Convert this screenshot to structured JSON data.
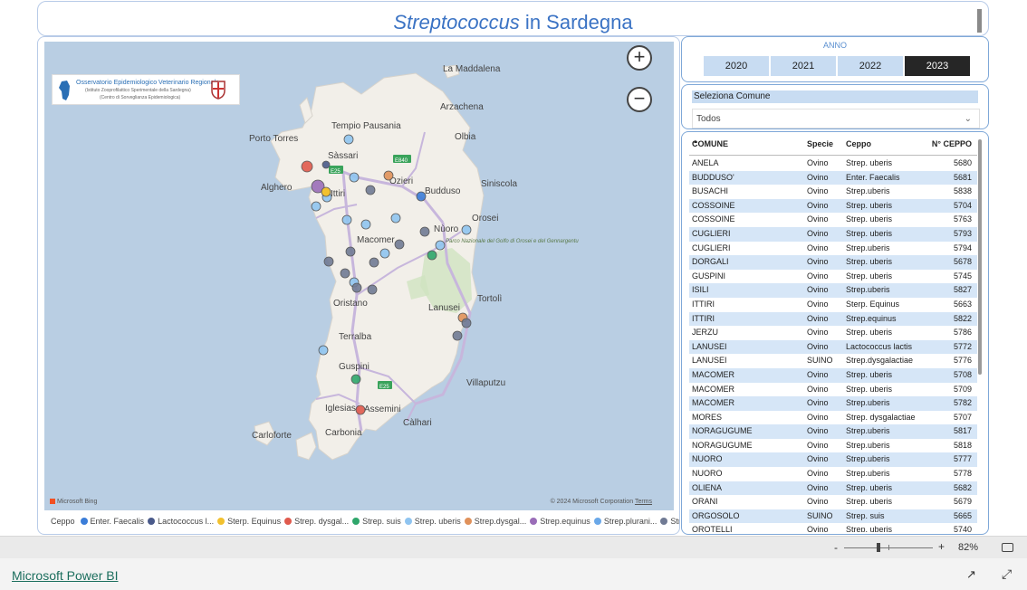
{
  "title": {
    "italic": "Streptococcus",
    "rest": " in Sardegna"
  },
  "map": {
    "zoom_in": "+",
    "zoom_out": "−",
    "places": [
      "La Maddalena",
      "Arzachena",
      "Tempio Pausania",
      "Olbia",
      "Porto Torres",
      "Sàssari",
      "Alghero",
      "Ozieri",
      "Ittiri",
      "Budduso",
      "Siniscola",
      "Orosei",
      "Nùoro",
      "Macomer",
      "Parco Nazionale del Golfo di Orosei e del Gennargentu",
      "Oristano",
      "Tortolì",
      "Lanusei",
      "Terralba",
      "Guspini",
      "Villaputzu",
      "Iglesias",
      "Assemini",
      "Càlhari",
      "Carloforte",
      "Carbonia"
    ],
    "road_labels": [
      "E25",
      "E840",
      "E25",
      "E25"
    ],
    "logo": {
      "line1": "Osservatorio Epidemiologico Veterinario Regionale",
      "line2": "(Istituto Zooprofilattico Sperimentale della Sardegna)",
      "line3": "(Centro di Sorveglianza Epidemiologica)"
    },
    "bing": "Microsoft Bing",
    "copyright": "© 2024 Microsoft Corporation",
    "terms": "Terms"
  },
  "legend": {
    "title": "Ceppo",
    "items": [
      {
        "label": "Enter. Faecalis",
        "color": "#3b7dd8"
      },
      {
        "label": "Lactococcus l...",
        "color": "#4a5a8a"
      },
      {
        "label": "Sterp. Equinus",
        "color": "#f2c12e"
      },
      {
        "label": "Strep. dysgal...",
        "color": "#e05a4d"
      },
      {
        "label": "Strep. suis",
        "color": "#2fa66b"
      },
      {
        "label": "Strep. uberis",
        "color": "#8fc4f0"
      },
      {
        "label": "Strep.dysgal...",
        "color": "#e0915a"
      },
      {
        "label": "Strep.equinus",
        "color": "#9a6db8"
      },
      {
        "label": "Strep.plurani...",
        "color": "#6aa8e8"
      },
      {
        "label": "Strep.uberis",
        "color": "#707a94"
      }
    ]
  },
  "year_slicer": {
    "label": "ANNO",
    "years": [
      "2020",
      "2021",
      "2022",
      "2023"
    ],
    "selected": "2023"
  },
  "comune_slicer": {
    "label": "Seleziona Comune",
    "value": "Todos"
  },
  "table": {
    "headers": [
      "COMUNE",
      "Specie",
      "Ceppo",
      "N° CEPPO"
    ],
    "rows": [
      [
        "ANELA",
        "Ovino",
        "Strep. uberis",
        "5680"
      ],
      [
        "BUDDUSO'",
        "Ovino",
        "Enter. Faecalis",
        "5681"
      ],
      [
        "BUSACHI",
        "Ovino",
        "Strep.uberis",
        "5838"
      ],
      [
        "COSSOINE",
        "Ovino",
        "Strep. uberis",
        "5704"
      ],
      [
        "COSSOINE",
        "Ovino",
        "Strep. uberis",
        "5763"
      ],
      [
        "CUGLIERI",
        "Ovino",
        "Strep. uberis",
        "5793"
      ],
      [
        "CUGLIERI",
        "Ovino",
        "Strep.uberis",
        "5794"
      ],
      [
        "DORGALI",
        "Ovino",
        "Strep. uberis",
        "5678"
      ],
      [
        "GUSPINI",
        "Ovino",
        "Strep. uberis",
        "5745"
      ],
      [
        "ISILI",
        "Ovino",
        "Strep.uberis",
        "5827"
      ],
      [
        "ITTIRI",
        "Ovino",
        "Sterp. Equinus",
        "5663"
      ],
      [
        "ITTIRI",
        "Ovino",
        "Strep.equinus",
        "5822"
      ],
      [
        "JERZU",
        "Ovino",
        "Strep. uberis",
        "5786"
      ],
      [
        "LANUSEI",
        "Ovino",
        "Lactococcus lactis",
        "5772"
      ],
      [
        "LANUSEI",
        "SUINO",
        "Strep.dysgalactiae",
        "5776"
      ],
      [
        "MACOMER",
        "Ovino",
        "Strep. uberis",
        "5708"
      ],
      [
        "MACOMER",
        "Ovino",
        "Strep. uberis",
        "5709"
      ],
      [
        "MACOMER",
        "Ovino",
        "Strep.uberis",
        "5782"
      ],
      [
        "MORES",
        "Ovino",
        "Strep. dysgalactiae",
        "5707"
      ],
      [
        "NORAGUGUME",
        "Ovino",
        "Strep.uberis",
        "5817"
      ],
      [
        "NORAGUGUME",
        "Ovino",
        "Strep.uberis",
        "5818"
      ],
      [
        "NUORO",
        "Ovino",
        "Strep.uberis",
        "5777"
      ],
      [
        "NUORO",
        "Ovino",
        "Strep.uberis",
        "5778"
      ],
      [
        "OLIENA",
        "Ovino",
        "Strep. uberis",
        "5682"
      ],
      [
        "ORANI",
        "Ovino",
        "Strep. uberis",
        "5679"
      ],
      [
        "ORGOSOLO",
        "SUINO",
        "Strep. suis",
        "5665"
      ],
      [
        "OROTELLI",
        "Ovino",
        "Strep. uberis",
        "5740"
      ]
    ]
  },
  "zoom": {
    "minus": "-",
    "plus": "+",
    "percent": "82%"
  },
  "footer": {
    "brand": "Microsoft Power BI",
    "share_icon": "share-icon",
    "expand_icon": "expand-icon"
  }
}
